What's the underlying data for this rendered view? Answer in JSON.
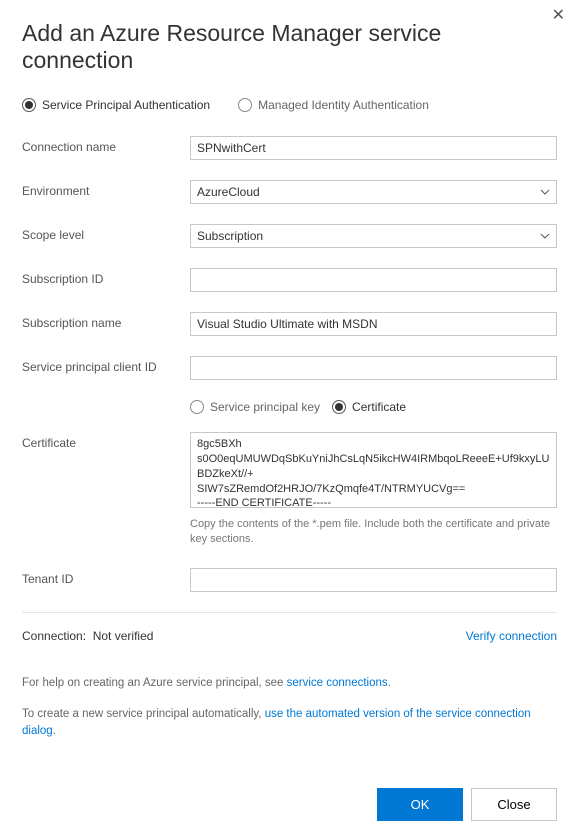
{
  "title": "Add an Azure Resource Manager service connection",
  "auth": {
    "option_sp": "Service Principal Authentication",
    "option_mi": "Managed Identity Authentication",
    "selected": "sp"
  },
  "fields": {
    "connection_name": {
      "label": "Connection name",
      "value": "SPNwithCert"
    },
    "environment": {
      "label": "Environment",
      "value": "AzureCloud"
    },
    "scope_level": {
      "label": "Scope level",
      "value": "Subscription"
    },
    "subscription_id": {
      "label": "Subscription ID",
      "value": ""
    },
    "subscription_name": {
      "label": "Subscription name",
      "value": "Visual Studio Ultimate with MSDN"
    },
    "sp_client_id": {
      "label": "Service principal client ID",
      "value": ""
    },
    "credential_kind": {
      "option_key": "Service principal key",
      "option_cert": "Certificate",
      "selected": "cert"
    },
    "certificate": {
      "label": "Certificate",
      "value": "8gc5BXh\ns0O0eqUMUWDqSbKuYniJhCsLqN5ikcHW4IRMbqoLReeeE+Uf9kxyLUBDZkeXt//+\nSIW7sZRemdOf2HRJO/7KzQmqfe4T/NTRMYUCVg==\n-----END CERTIFICATE-----",
      "help": "Copy the contents of the *.pem file. Include both the certificate and private key sections."
    },
    "tenant_id": {
      "label": "Tenant ID",
      "value": ""
    }
  },
  "verify": {
    "status_label": "Connection:",
    "status_value": "Not verified",
    "link": "Verify connection"
  },
  "help": {
    "line1_pre": "For help on creating an Azure service principal, see ",
    "line1_link": "service connections",
    "line1_post": ".",
    "line2_pre": "To create a new service principal automatically, ",
    "line2_link": "use the automated version of the service connection dialog",
    "line2_post": "."
  },
  "buttons": {
    "ok": "OK",
    "close": "Close"
  }
}
